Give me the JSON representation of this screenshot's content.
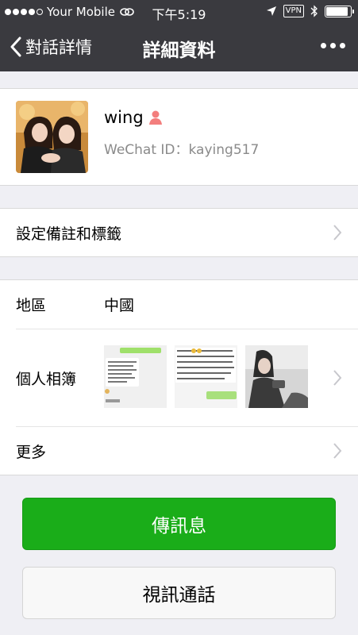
{
  "status_bar": {
    "carrier": "Your Mobile",
    "time": "下午5:19",
    "vpn": "VPN",
    "signal_filled": 4,
    "signal_total": 5,
    "battery_level": 0.9
  },
  "nav": {
    "back_label": "對話詳情",
    "title": "詳細資料"
  },
  "profile": {
    "name": "wing",
    "gender": "female",
    "wechat_id": "WeChat ID：kaying517"
  },
  "remark_row": {
    "label": "設定備註和標籤"
  },
  "info": {
    "region_label": "地區",
    "region_value": "中國",
    "album_label": "個人相簿",
    "more_label": "更多"
  },
  "actions": {
    "message_label": "傳訊息",
    "video_call_label": "視訊通話"
  },
  "colors": {
    "nav_bg": "#3a3a3f",
    "primary_green": "#1aad19",
    "page_bg": "#efeff4",
    "secondary_text": "#8a8a8a"
  }
}
